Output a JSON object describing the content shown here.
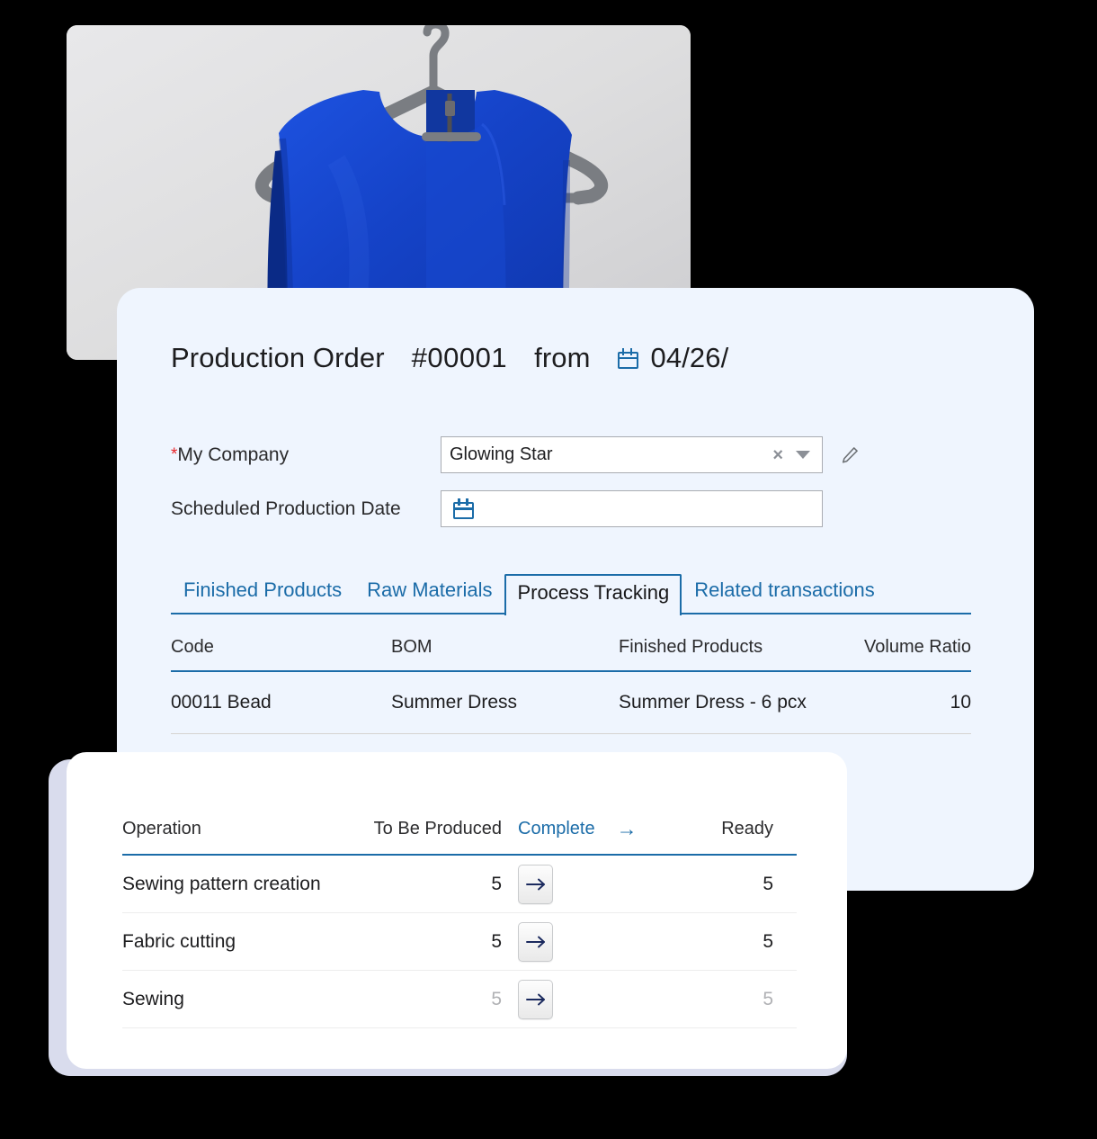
{
  "photo": {
    "alt": "blue sleeveless dress on gray hanger"
  },
  "header": {
    "title": "Production Order",
    "order_number": "#00001",
    "from_label": "from",
    "date": "04/26/",
    "calendar_icon": "calendar-icon"
  },
  "form": {
    "company": {
      "label": "My Company",
      "required_marker": "*",
      "value": "Glowing Star",
      "clear_icon": "×",
      "dropdown_icon": "chevron-down-icon",
      "edit_icon": "pencil-icon"
    },
    "date": {
      "label": "Scheduled Production Date",
      "value": "",
      "calendar_icon": "calendar-icon"
    }
  },
  "tabs": [
    {
      "label": "Finished Products",
      "active": false
    },
    {
      "label": "Raw Materials",
      "active": false
    },
    {
      "label": "Process Tracking",
      "active": true
    },
    {
      "label": "Related transactions",
      "active": false
    }
  ],
  "materials_table": {
    "columns": [
      "Code",
      "BOM",
      "Finished Products",
      "Volume Ratio"
    ],
    "rows": [
      {
        "code": "00011 Bead",
        "bom": "Summer Dress",
        "finished_products": "Summer Dress - 6 pcx",
        "volume_ratio": "10"
      }
    ]
  },
  "operations_table": {
    "columns": {
      "operation": "Operation",
      "to_be_produced": "To Be Produced",
      "complete": "Complete",
      "complete_arrow": "→",
      "ready": "Ready"
    },
    "rows": [
      {
        "operation": "Sewing pattern creation",
        "to_be_produced": "5",
        "action_icon": "→",
        "ready": "5",
        "dim": false
      },
      {
        "operation": "Fabric cutting",
        "to_be_produced": "5",
        "action_icon": "→",
        "ready": "5",
        "dim": false
      },
      {
        "operation": "Sewing",
        "to_be_produced": "5",
        "action_icon": "→",
        "ready": "5",
        "dim": true
      }
    ]
  },
  "colors": {
    "accent_blue": "#1b6ca8",
    "panel_bg": "#eff5fe",
    "card_bg": "#ffffff",
    "required_red": "#e8252a",
    "dress_blue": "#1543c8"
  }
}
